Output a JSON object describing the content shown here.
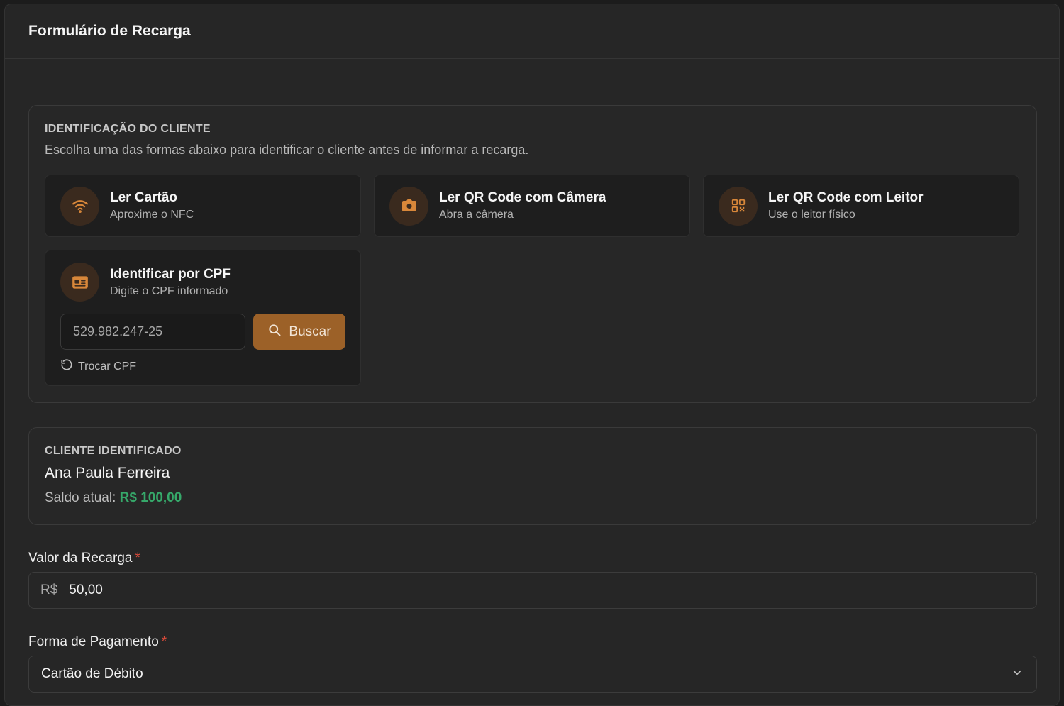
{
  "header": {
    "title": "Formulário de Recarga"
  },
  "identification": {
    "title": "IDENTIFICAÇÃO DO CLIENTE",
    "description": "Escolha uma das formas abaixo para identificar o cliente antes de informar a recarga.",
    "methods": [
      {
        "title": "Ler Cartão",
        "subtitle": "Aproxime o NFC",
        "icon": "nfc-icon"
      },
      {
        "title": "Ler QR Code com Câmera",
        "subtitle": "Abra a câmera",
        "icon": "camera-icon"
      },
      {
        "title": "Ler QR Code com Leitor",
        "subtitle": "Use o leitor físico",
        "icon": "qr-code-icon"
      }
    ],
    "cpf": {
      "title": "Identificar por CPF",
      "subtitle": "Digite o CPF informado",
      "input_value": "529.982.247-25",
      "search_label": "Buscar",
      "swap_label": "Trocar CPF"
    }
  },
  "client": {
    "title": "CLIENTE IDENTIFICADO",
    "name": "Ana Paula Ferreira",
    "balance_label": "Saldo atual:",
    "balance_value": "R$ 100,00"
  },
  "form": {
    "amount_label": "Valor da Recarga",
    "amount_prefix": "R$",
    "amount_value": "50,00",
    "payment_label": "Forma de Pagamento",
    "payment_value": "Cartão de Débito",
    "required_mark": "*"
  },
  "colors": {
    "accent": "#9c6128",
    "icon_accent": "#d8873a",
    "success": "#36a86a",
    "required": "#d84a3a"
  }
}
